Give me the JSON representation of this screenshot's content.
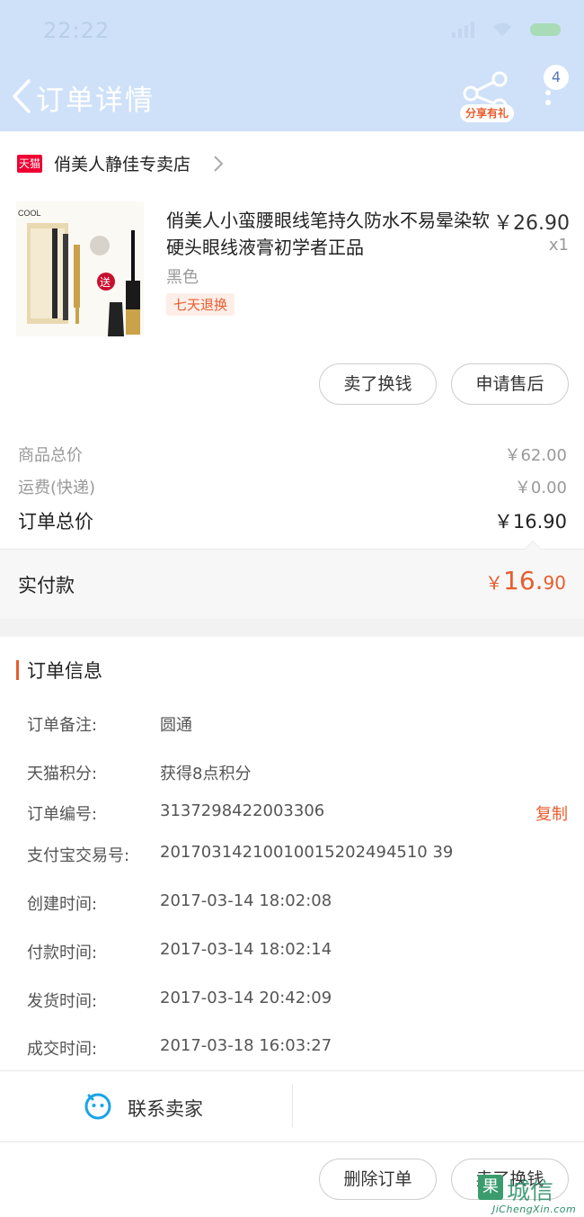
{
  "status_bar": {
    "time": "22:22"
  },
  "header": {
    "title": "订单详情",
    "share_label": "分享有礼",
    "badge_count": "4",
    "accent_color": "#cfe1f9",
    "icons": [
      "back-arrow-icon",
      "share-icon",
      "more-dots-icon"
    ]
  },
  "store": {
    "badge": "天猫",
    "name": "俏美人静佳专卖店"
  },
  "product": {
    "name": "俏美人小蛮腰眼线笔持久防水不易晕染软硬头眼线液膏初学者正品",
    "price": "￥26.90",
    "qty": "x1",
    "spec": "黑色",
    "return_tag": "七天退换",
    "image_brand": "COOL",
    "image_gift": "送",
    "btn_sell": "卖了换钱",
    "btn_aftersale": "申请售后"
  },
  "pricing": {
    "goods_total_label": "商品总价",
    "goods_total": "￥62.00",
    "shipping_label": "运费(快递)",
    "shipping": "￥0.00",
    "order_total_label": "订单总价",
    "order_total": "￥16.90",
    "paid_label": "实付款",
    "paid_currency": "￥",
    "paid_int": "16.",
    "paid_dec": "90"
  },
  "order_info": {
    "title": "订单信息",
    "rows": [
      {
        "k": "订单备注:",
        "v": "圆通"
      },
      {
        "k": "天猫积分:",
        "v": "获得8点积分"
      },
      {
        "k": "订单编号:",
        "v": "3137298422003306"
      },
      {
        "k": "支付宝交易号:",
        "v": "20170314210010015202494510 39"
      },
      {
        "k": "创建时间:",
        "v": "2017-03-14 18:02:08"
      },
      {
        "k": "付款时间:",
        "v": "2017-03-14 18:02:14"
      },
      {
        "k": "发货时间:",
        "v": "2017-03-14 20:42:09"
      },
      {
        "k": "成交时间:",
        "v": "2017-03-18 16:03:27"
      }
    ],
    "copy_label": "复制"
  },
  "bottom": {
    "contact_label": "联系卖家",
    "btn_delete": "删除订单",
    "btn_sell": "卖了换钱"
  },
  "watermark": {
    "char": "果",
    "big": "城信",
    "url": "JiChengXin.com"
  }
}
